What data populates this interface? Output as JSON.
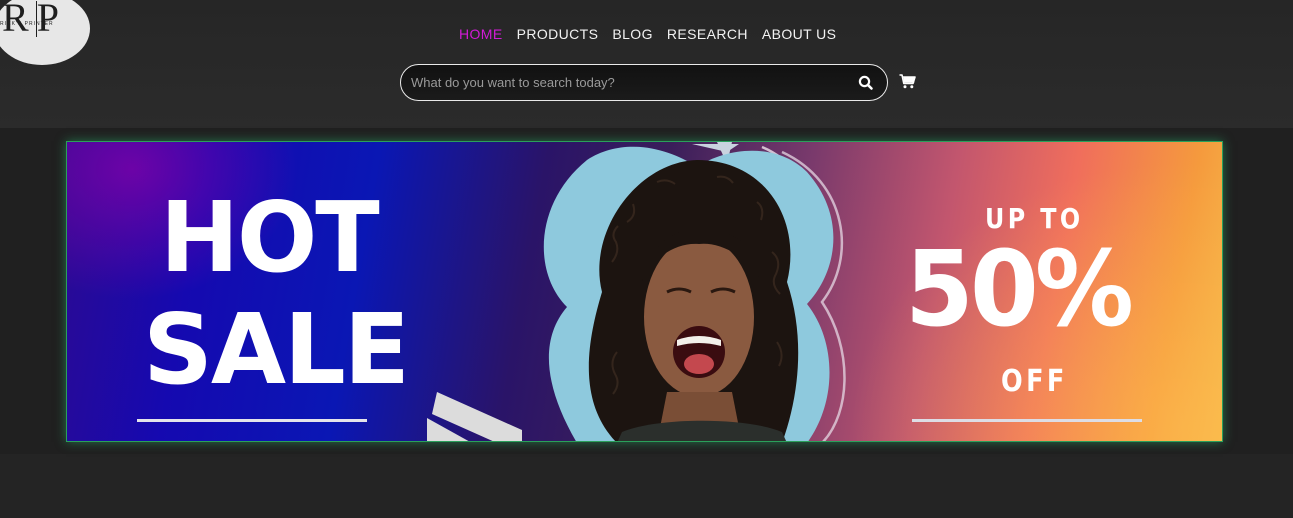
{
  "brand": {
    "logo_letters": "R|P",
    "logo_subtitle": "RICK'S PRINTER"
  },
  "nav": {
    "items": [
      {
        "label": "HOME",
        "active": true
      },
      {
        "label": "PRODUCTS",
        "active": false
      },
      {
        "label": "BLOG",
        "active": false
      },
      {
        "label": "RESEARCH",
        "active": false
      },
      {
        "label": "ABOUT US",
        "active": false
      }
    ],
    "active_color": "#d21bd6"
  },
  "search": {
    "placeholder": "What do you want to search today?",
    "value": "",
    "button_icon": "search-icon"
  },
  "cart": {
    "icon": "cart-icon"
  },
  "banner": {
    "headline_line1": "HOT",
    "headline_line2": "SALE",
    "offer_top": "UP TO",
    "offer_value": "50%",
    "offer_bottom": "OFF",
    "border_color": "#2aa05a"
  }
}
